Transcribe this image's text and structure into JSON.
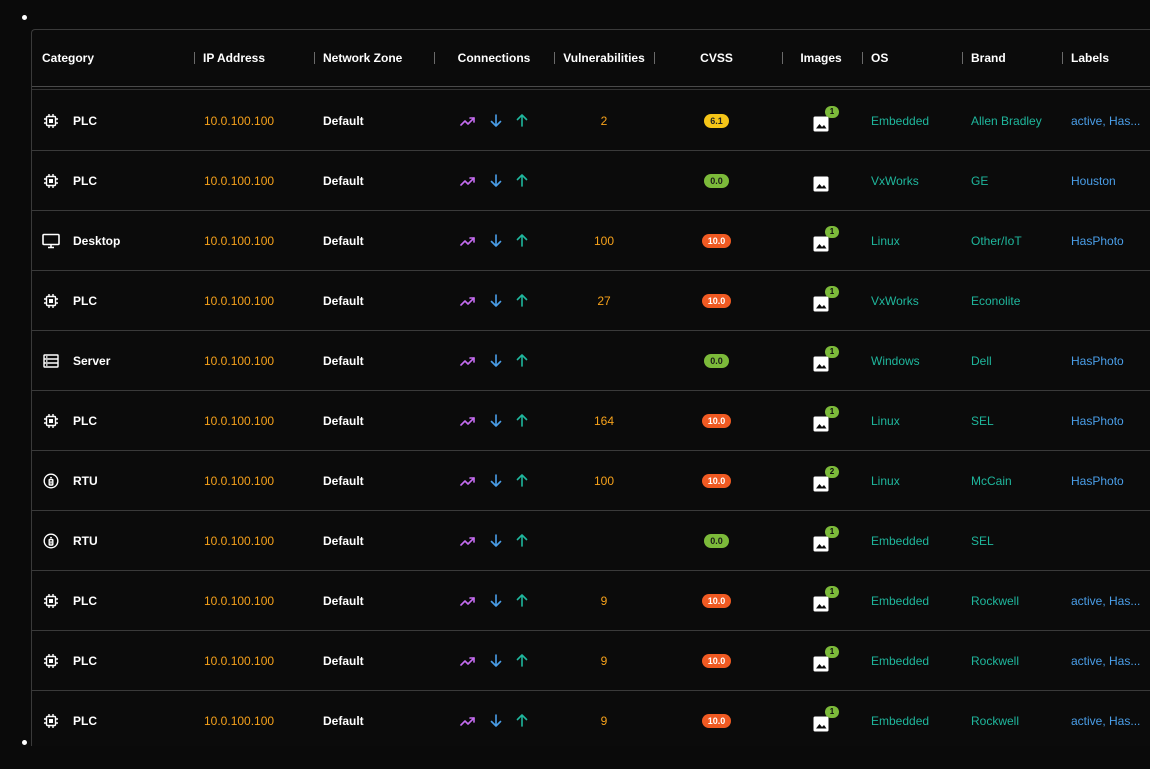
{
  "columns": [
    {
      "key": "category",
      "label": "Category"
    },
    {
      "key": "ip",
      "label": "IP Address"
    },
    {
      "key": "zone",
      "label": "Network Zone"
    },
    {
      "key": "connections",
      "label": "Connections"
    },
    {
      "key": "vulnerabilities",
      "label": "Vulnerabilities"
    },
    {
      "key": "cvss",
      "label": "CVSS"
    },
    {
      "key": "images",
      "label": "Images"
    },
    {
      "key": "os",
      "label": "OS"
    },
    {
      "key": "brand",
      "label": "Brand"
    },
    {
      "key": "labels",
      "label": "Labels"
    }
  ],
  "colors": {
    "ip": "#f7a21b",
    "os": "#1fb79d",
    "labels": "#4a9ee8",
    "cvss_critical": "#f05a22",
    "cvss_medium": "#f5c518",
    "cvss_none": "#7cba3a",
    "connection_trend": "#c46cf0",
    "connection_down": "#4a9ee8",
    "connection_up": "#1fb79d"
  },
  "rows": [
    {
      "icon": "chip-icon",
      "category": "PLC",
      "ip": "10.0.100.100",
      "zone": "Default",
      "vulnerabilities": "2",
      "cvss": "6.1",
      "cvss_level": "medium",
      "images": "1",
      "os": "Embedded",
      "brand": "Allen Bradley",
      "labels": "active, Has..."
    },
    {
      "icon": "chip-icon",
      "category": "PLC",
      "ip": "10.0.100.100",
      "zone": "Default",
      "vulnerabilities": "",
      "cvss": "0.0",
      "cvss_level": "none",
      "images": "",
      "os": "VxWorks",
      "brand": "GE",
      "labels": "Houston"
    },
    {
      "icon": "monitor-icon",
      "category": "Desktop",
      "ip": "10.0.100.100",
      "zone": "Default",
      "vulnerabilities": "100",
      "cvss": "10.0",
      "cvss_level": "critical",
      "images": "1",
      "os": "Linux",
      "brand": "Other/IoT",
      "labels": "HasPhoto"
    },
    {
      "icon": "chip-icon",
      "category": "PLC",
      "ip": "10.0.100.100",
      "zone": "Default",
      "vulnerabilities": "27",
      "cvss": "10.0",
      "cvss_level": "critical",
      "images": "1",
      "os": "VxWorks",
      "brand": "Econolite",
      "labels": ""
    },
    {
      "icon": "server-icon",
      "category": "Server",
      "ip": "10.0.100.100",
      "zone": "Default",
      "vulnerabilities": "",
      "cvss": "0.0",
      "cvss_level": "none",
      "images": "1",
      "os": "Windows",
      "brand": "Dell",
      "labels": "HasPhoto"
    },
    {
      "icon": "chip-icon",
      "category": "PLC",
      "ip": "10.0.100.100",
      "zone": "Default",
      "vulnerabilities": "164",
      "cvss": "10.0",
      "cvss_level": "critical",
      "images": "1",
      "os": "Linux",
      "brand": "SEL",
      "labels": "HasPhoto"
    },
    {
      "icon": "rtu-icon",
      "category": "RTU",
      "ip": "10.0.100.100",
      "zone": "Default",
      "vulnerabilities": "100",
      "cvss": "10.0",
      "cvss_level": "critical",
      "images": "2",
      "os": "Linux",
      "brand": "McCain",
      "labels": "HasPhoto"
    },
    {
      "icon": "rtu-icon",
      "category": "RTU",
      "ip": "10.0.100.100",
      "zone": "Default",
      "vulnerabilities": "",
      "cvss": "0.0",
      "cvss_level": "none",
      "images": "1",
      "os": "Embedded",
      "brand": "SEL",
      "labels": ""
    },
    {
      "icon": "chip-icon",
      "category": "PLC",
      "ip": "10.0.100.100",
      "zone": "Default",
      "vulnerabilities": "9",
      "cvss": "10.0",
      "cvss_level": "critical",
      "images": "1",
      "os": "Embedded",
      "brand": "Rockwell",
      "labels": "active, Has..."
    },
    {
      "icon": "chip-icon",
      "category": "PLC",
      "ip": "10.0.100.100",
      "zone": "Default",
      "vulnerabilities": "9",
      "cvss": "10.0",
      "cvss_level": "critical",
      "images": "1",
      "os": "Embedded",
      "brand": "Rockwell",
      "labels": "active, Has..."
    },
    {
      "icon": "chip-icon",
      "category": "PLC",
      "ip": "10.0.100.100",
      "zone": "Default",
      "vulnerabilities": "9",
      "cvss": "10.0",
      "cvss_level": "critical",
      "images": "1",
      "os": "Embedded",
      "brand": "Rockwell",
      "labels": "active, Has..."
    }
  ]
}
